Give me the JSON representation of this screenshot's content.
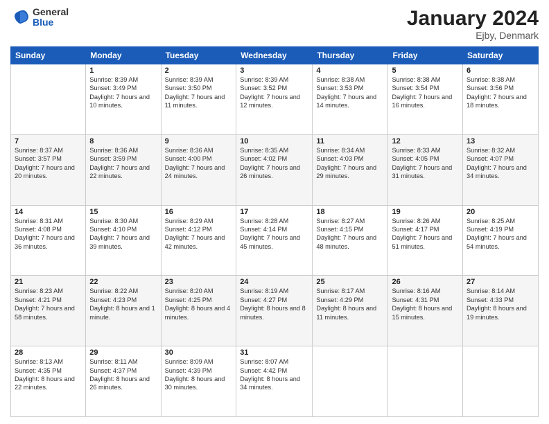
{
  "logo": {
    "general": "General",
    "blue": "Blue"
  },
  "header": {
    "month": "January 2024",
    "location": "Ejby, Denmark"
  },
  "days_of_week": [
    "Sunday",
    "Monday",
    "Tuesday",
    "Wednesday",
    "Thursday",
    "Friday",
    "Saturday"
  ],
  "weeks": [
    [
      {
        "day": "",
        "sunrise": "",
        "sunset": "",
        "daylight": ""
      },
      {
        "day": "1",
        "sunrise": "Sunrise: 8:39 AM",
        "sunset": "Sunset: 3:49 PM",
        "daylight": "Daylight: 7 hours and 10 minutes."
      },
      {
        "day": "2",
        "sunrise": "Sunrise: 8:39 AM",
        "sunset": "Sunset: 3:50 PM",
        "daylight": "Daylight: 7 hours and 11 minutes."
      },
      {
        "day": "3",
        "sunrise": "Sunrise: 8:39 AM",
        "sunset": "Sunset: 3:52 PM",
        "daylight": "Daylight: 7 hours and 12 minutes."
      },
      {
        "day": "4",
        "sunrise": "Sunrise: 8:38 AM",
        "sunset": "Sunset: 3:53 PM",
        "daylight": "Daylight: 7 hours and 14 minutes."
      },
      {
        "day": "5",
        "sunrise": "Sunrise: 8:38 AM",
        "sunset": "Sunset: 3:54 PM",
        "daylight": "Daylight: 7 hours and 16 minutes."
      },
      {
        "day": "6",
        "sunrise": "Sunrise: 8:38 AM",
        "sunset": "Sunset: 3:56 PM",
        "daylight": "Daylight: 7 hours and 18 minutes."
      }
    ],
    [
      {
        "day": "7",
        "sunrise": "Sunrise: 8:37 AM",
        "sunset": "Sunset: 3:57 PM",
        "daylight": "Daylight: 7 hours and 20 minutes."
      },
      {
        "day": "8",
        "sunrise": "Sunrise: 8:36 AM",
        "sunset": "Sunset: 3:59 PM",
        "daylight": "Daylight: 7 hours and 22 minutes."
      },
      {
        "day": "9",
        "sunrise": "Sunrise: 8:36 AM",
        "sunset": "Sunset: 4:00 PM",
        "daylight": "Daylight: 7 hours and 24 minutes."
      },
      {
        "day": "10",
        "sunrise": "Sunrise: 8:35 AM",
        "sunset": "Sunset: 4:02 PM",
        "daylight": "Daylight: 7 hours and 26 minutes."
      },
      {
        "day": "11",
        "sunrise": "Sunrise: 8:34 AM",
        "sunset": "Sunset: 4:03 PM",
        "daylight": "Daylight: 7 hours and 29 minutes."
      },
      {
        "day": "12",
        "sunrise": "Sunrise: 8:33 AM",
        "sunset": "Sunset: 4:05 PM",
        "daylight": "Daylight: 7 hours and 31 minutes."
      },
      {
        "day": "13",
        "sunrise": "Sunrise: 8:32 AM",
        "sunset": "Sunset: 4:07 PM",
        "daylight": "Daylight: 7 hours and 34 minutes."
      }
    ],
    [
      {
        "day": "14",
        "sunrise": "Sunrise: 8:31 AM",
        "sunset": "Sunset: 4:08 PM",
        "daylight": "Daylight: 7 hours and 36 minutes."
      },
      {
        "day": "15",
        "sunrise": "Sunrise: 8:30 AM",
        "sunset": "Sunset: 4:10 PM",
        "daylight": "Daylight: 7 hours and 39 minutes."
      },
      {
        "day": "16",
        "sunrise": "Sunrise: 8:29 AM",
        "sunset": "Sunset: 4:12 PM",
        "daylight": "Daylight: 7 hours and 42 minutes."
      },
      {
        "day": "17",
        "sunrise": "Sunrise: 8:28 AM",
        "sunset": "Sunset: 4:14 PM",
        "daylight": "Daylight: 7 hours and 45 minutes."
      },
      {
        "day": "18",
        "sunrise": "Sunrise: 8:27 AM",
        "sunset": "Sunset: 4:15 PM",
        "daylight": "Daylight: 7 hours and 48 minutes."
      },
      {
        "day": "19",
        "sunrise": "Sunrise: 8:26 AM",
        "sunset": "Sunset: 4:17 PM",
        "daylight": "Daylight: 7 hours and 51 minutes."
      },
      {
        "day": "20",
        "sunrise": "Sunrise: 8:25 AM",
        "sunset": "Sunset: 4:19 PM",
        "daylight": "Daylight: 7 hours and 54 minutes."
      }
    ],
    [
      {
        "day": "21",
        "sunrise": "Sunrise: 8:23 AM",
        "sunset": "Sunset: 4:21 PM",
        "daylight": "Daylight: 7 hours and 58 minutes."
      },
      {
        "day": "22",
        "sunrise": "Sunrise: 8:22 AM",
        "sunset": "Sunset: 4:23 PM",
        "daylight": "Daylight: 8 hours and 1 minute."
      },
      {
        "day": "23",
        "sunrise": "Sunrise: 8:20 AM",
        "sunset": "Sunset: 4:25 PM",
        "daylight": "Daylight: 8 hours and 4 minutes."
      },
      {
        "day": "24",
        "sunrise": "Sunrise: 8:19 AM",
        "sunset": "Sunset: 4:27 PM",
        "daylight": "Daylight: 8 hours and 8 minutes."
      },
      {
        "day": "25",
        "sunrise": "Sunrise: 8:17 AM",
        "sunset": "Sunset: 4:29 PM",
        "daylight": "Daylight: 8 hours and 11 minutes."
      },
      {
        "day": "26",
        "sunrise": "Sunrise: 8:16 AM",
        "sunset": "Sunset: 4:31 PM",
        "daylight": "Daylight: 8 hours and 15 minutes."
      },
      {
        "day": "27",
        "sunrise": "Sunrise: 8:14 AM",
        "sunset": "Sunset: 4:33 PM",
        "daylight": "Daylight: 8 hours and 19 minutes."
      }
    ],
    [
      {
        "day": "28",
        "sunrise": "Sunrise: 8:13 AM",
        "sunset": "Sunset: 4:35 PM",
        "daylight": "Daylight: 8 hours and 22 minutes."
      },
      {
        "day": "29",
        "sunrise": "Sunrise: 8:11 AM",
        "sunset": "Sunset: 4:37 PM",
        "daylight": "Daylight: 8 hours and 26 minutes."
      },
      {
        "day": "30",
        "sunrise": "Sunrise: 8:09 AM",
        "sunset": "Sunset: 4:39 PM",
        "daylight": "Daylight: 8 hours and 30 minutes."
      },
      {
        "day": "31",
        "sunrise": "Sunrise: 8:07 AM",
        "sunset": "Sunset: 4:42 PM",
        "daylight": "Daylight: 8 hours and 34 minutes."
      },
      {
        "day": "",
        "sunrise": "",
        "sunset": "",
        "daylight": ""
      },
      {
        "day": "",
        "sunrise": "",
        "sunset": "",
        "daylight": ""
      },
      {
        "day": "",
        "sunrise": "",
        "sunset": "",
        "daylight": ""
      }
    ]
  ]
}
